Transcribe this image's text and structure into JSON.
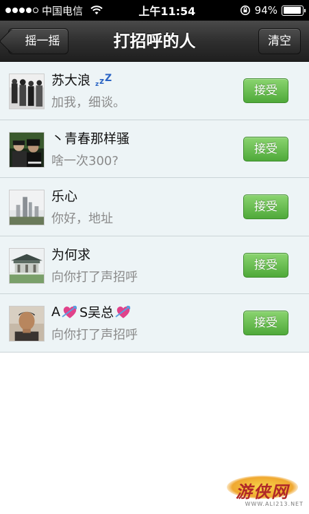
{
  "status_bar": {
    "carrier": "中国电信",
    "time": "上午11:54",
    "battery": "94%",
    "battery_level": 0.94
  },
  "nav": {
    "back_label": "摇一摇",
    "title": "打招呼的人",
    "clear_label": "清空"
  },
  "people": [
    {
      "name": "苏大浪",
      "message": "加我，细谈。",
      "accept_label": "接受"
    },
    {
      "name": "丶青春那样骚",
      "message": "啥一次300?",
      "accept_label": "接受"
    },
    {
      "name": "乐心",
      "message": "你好，地址",
      "accept_label": "接受"
    },
    {
      "name": "为何求",
      "message": "向你打了声招呼",
      "accept_label": "接受"
    },
    {
      "name_part1": "A",
      "name_part2": "S吴总",
      "message": "向你打了声招呼",
      "accept_label": "接受"
    }
  ],
  "watermark": {
    "brand": "游侠网",
    "url": "WWW.ALI213.NET"
  },
  "icons": {
    "wifi": "wifi-icon",
    "rotation_lock": "rotation-lock-icon",
    "battery": "battery-icon",
    "back": "chevron-left-icon",
    "sleep": "zzz-icon",
    "heart": "heart-icon"
  },
  "colors": {
    "accept_green": "#5cb848",
    "row_bg": "#edf4f6",
    "nav_dark": "#2f2f2f"
  }
}
